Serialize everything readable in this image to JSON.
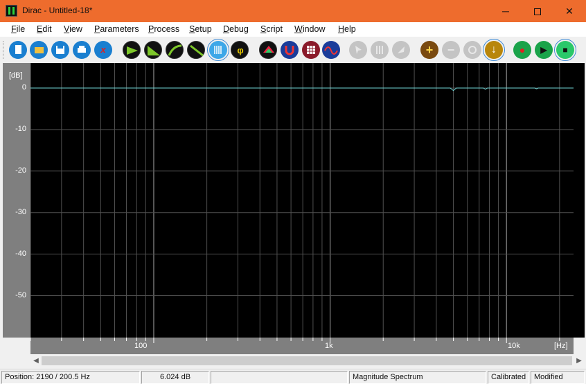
{
  "window": {
    "title": "Dirac - Untitled-18*",
    "minimize_glyph": "─",
    "close_glyph": "✕"
  },
  "menu": [
    {
      "label": "File",
      "underline": "F",
      "rest": "ile"
    },
    {
      "label": "Edit",
      "underline": "E",
      "rest": "dit"
    },
    {
      "label": "View",
      "underline": "V",
      "rest": "iew"
    },
    {
      "label": "Parameters",
      "underline": "P",
      "rest": "arameters"
    },
    {
      "label": "Process",
      "underline": "P",
      "rest": "rocess"
    },
    {
      "label": "Setup",
      "underline": "S",
      "rest": "etup"
    },
    {
      "label": "Debug",
      "underline": "D",
      "rest": "ebug"
    },
    {
      "label": "Script",
      "underline": "S",
      "rest": "cript"
    },
    {
      "label": "Window",
      "underline": "W",
      "rest": "indow"
    },
    {
      "label": "Help",
      "underline": "H",
      "rest": "elp"
    }
  ],
  "toolbar": {
    "phi_glyph": "φ",
    "x_glyph": "x",
    "plus_glyph": "+",
    "minus_glyph": "−",
    "down_glyph": "↓",
    "record_glyph": "●",
    "play_glyph": "▶",
    "stop_glyph": "■"
  },
  "colors": {
    "titlebar": "#ee6c2d",
    "plot_background": "#000000",
    "axis_panel": "#7f7f7f",
    "grid": "#505050",
    "trace": "#6fd6d6"
  },
  "chart_data": {
    "type": "line",
    "ylabel": "[dB]",
    "xlabel": "[Hz]",
    "yticks": [
      "0",
      "-10",
      "-20",
      "-30",
      "-40",
      "-50"
    ],
    "xtick_labels": [
      "100",
      "1k",
      "10k"
    ],
    "x_scale": "log",
    "xlim": [
      20,
      24000
    ],
    "ylim": [
      -60,
      2
    ],
    "grid": true,
    "series": [
      {
        "x": [
          20,
          100,
          1000,
          4800,
          5000,
          5200,
          7400,
          7600,
          7800,
          14500,
          14800,
          15100,
          24000
        ],
        "y": [
          0,
          0,
          0,
          0,
          -0.6,
          0,
          0,
          -0.3,
          0,
          0,
          -0.2,
          0,
          0
        ]
      }
    ]
  },
  "status": {
    "position": "Position: 2190 / 200.5 Hz",
    "level": "6.024 dB",
    "mode": "Magnitude Spectrum",
    "calibrated": "Calibrated",
    "modified": "Modified"
  }
}
